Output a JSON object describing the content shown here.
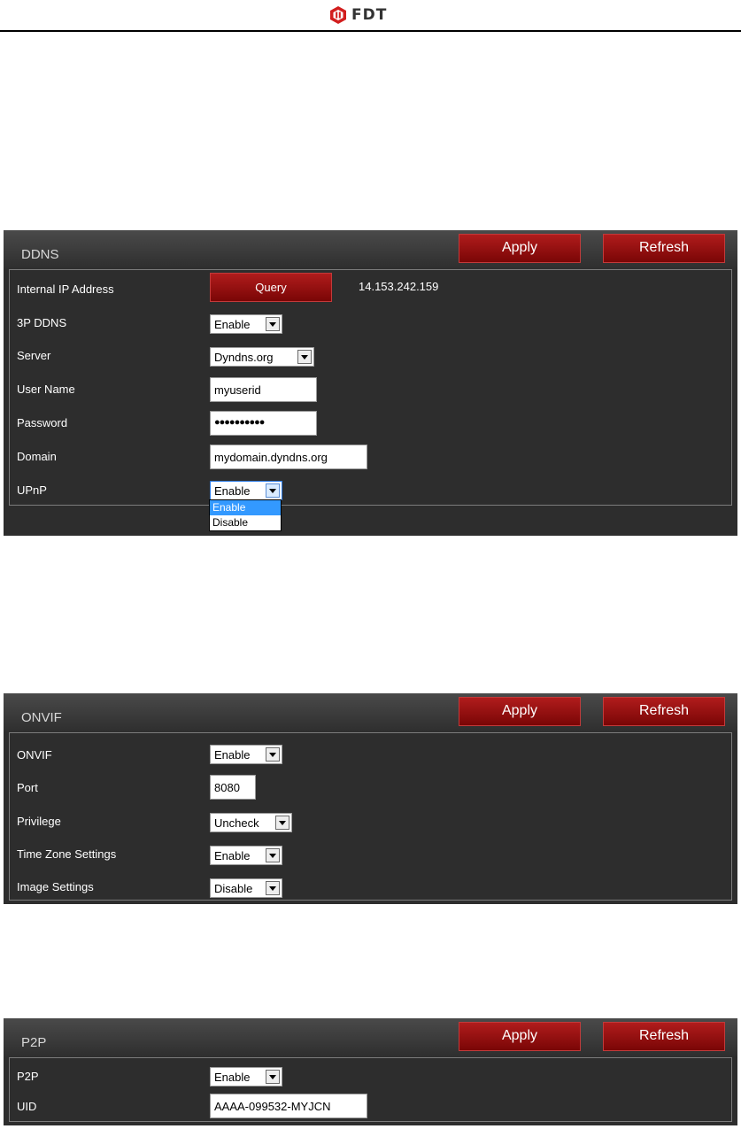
{
  "header": {
    "logo_text": "FDT"
  },
  "ddns": {
    "title": "DDNS",
    "apply_label": "Apply",
    "refresh_label": "Refresh",
    "internal_ip": {
      "label": "Internal IP Address",
      "button_label": "Query",
      "value": "14.153.242.159"
    },
    "ddns3p": {
      "label": "3P DDNS",
      "value": "Enable"
    },
    "server": {
      "label": "Server",
      "value": "Dyndns.org"
    },
    "username": {
      "label": "User Name",
      "value": "myuserid"
    },
    "password": {
      "label": "Password",
      "value": "●●●●●●●●●●"
    },
    "domain": {
      "label": "Domain",
      "value": "mydomain.dyndns.org"
    },
    "upnp": {
      "label": "UPnP",
      "value": "Enable",
      "options": [
        "Enable",
        "Disable"
      ]
    }
  },
  "onvif": {
    "title": "ONVIF",
    "apply_label": "Apply",
    "refresh_label": "Refresh",
    "onvif": {
      "label": "ONVIF",
      "value": "Enable"
    },
    "port": {
      "label": "Port",
      "value": "8080"
    },
    "privilege": {
      "label": "Privilege",
      "value": "Uncheck"
    },
    "timezone": {
      "label": "Time Zone Settings",
      "value": "Enable"
    },
    "image": {
      "label": "Image Settings",
      "value": "Disable"
    }
  },
  "p2p": {
    "title": "P2P",
    "apply_label": "Apply",
    "refresh_label": "Refresh",
    "p2p": {
      "label": "P2P",
      "value": "Enable"
    },
    "uid": {
      "label": "UID",
      "value": "AAAA-099532-MYJCN"
    }
  },
  "colors": {
    "accent_red": "#9b1010",
    "panel_bg": "#2d2d2d",
    "highlight_blue": "#3399ff"
  }
}
